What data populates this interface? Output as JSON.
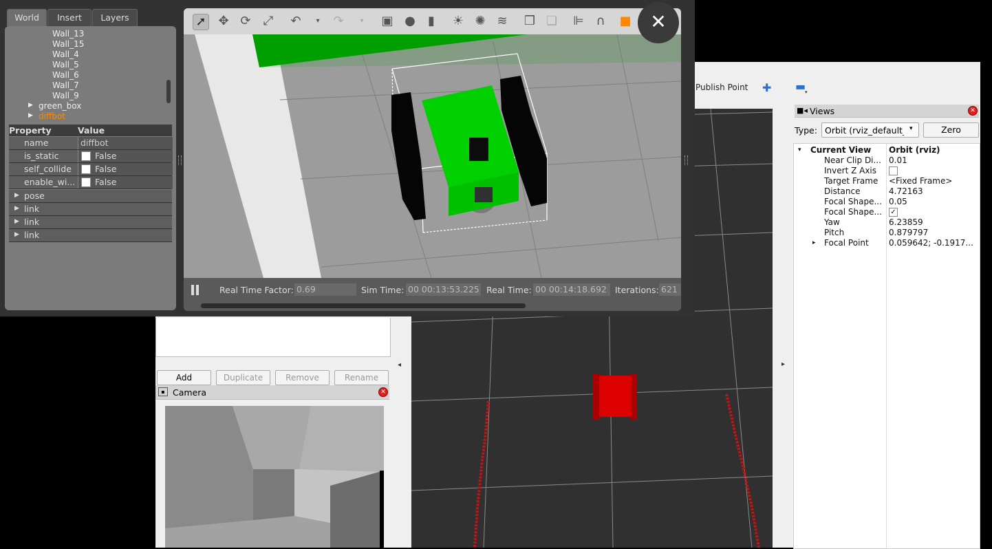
{
  "gazebo": {
    "tabs": [
      "World",
      "Insert",
      "Layers"
    ],
    "tree_items": [
      "Wall_13",
      "Wall_15",
      "Wall_4",
      "Wall_5",
      "Wall_6",
      "Wall_7",
      "Wall_9"
    ],
    "models": [
      "green_box",
      "diffbot"
    ],
    "property_header": {
      "property": "Property",
      "value": "Value"
    },
    "properties": [
      {
        "key": "name",
        "value": "diffbot"
      },
      {
        "key": "is_static",
        "value": "False"
      },
      {
        "key": "self_collide",
        "value": "False"
      },
      {
        "key": "enable_wi...",
        "value": "False"
      }
    ],
    "sub_items": [
      "pose",
      "link",
      "link",
      "link"
    ],
    "status": {
      "rtf_label": "Real Time Factor:",
      "rtf_value": "0.69",
      "sim_label": "Sim Time:",
      "sim_value": "00 00:13:53.225",
      "real_label": "Real Time:",
      "real_value": "00 00:14:18.692",
      "iter_label": "Iterations:",
      "iter_value": "621"
    },
    "close_symbol": "✕"
  },
  "rviz": {
    "toolbar": {
      "publish_point": "Publish Point"
    },
    "views": {
      "title": "Views",
      "type_label": "Type:",
      "type_value": "Orbit (rviz_default_p",
      "zero_button": "Zero",
      "current_view": {
        "key": "Current View",
        "value": "Orbit (rviz)"
      },
      "rows": [
        {
          "key": "Near Clip Di...",
          "value": "0.01"
        },
        {
          "key": "Invert Z Axis",
          "value": ""
        },
        {
          "key": "Target Frame",
          "value": "<Fixed Frame>"
        },
        {
          "key": "Distance",
          "value": "4.72163"
        },
        {
          "key": "Focal Shape...",
          "value": "0.05"
        },
        {
          "key": "Focal Shape...",
          "value": ""
        },
        {
          "key": "Yaw",
          "value": "6.23859"
        },
        {
          "key": "Pitch",
          "value": "0.879797"
        },
        {
          "key": "Focal Point",
          "value": "0.059642; -0.1917..."
        }
      ]
    },
    "buttons": {
      "add": "Add",
      "duplicate": "Duplicate",
      "remove": "Remove",
      "rename": "Rename"
    },
    "camera_title": "Camera"
  },
  "colors": {
    "robot_green": "#22ee22",
    "robot_red": "#dd0000",
    "model_orange": "#ff8800"
  }
}
